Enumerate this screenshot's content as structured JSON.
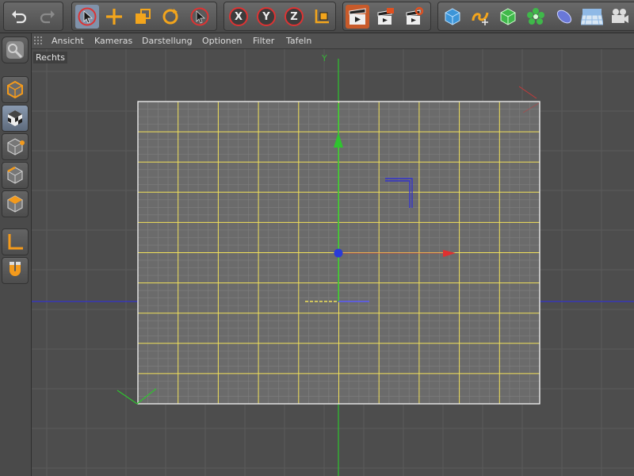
{
  "toolbar": {
    "groups": [
      "undo-redo",
      "tools",
      "axis-lock",
      "render",
      "objects"
    ],
    "axis_labels": {
      "x": "X",
      "y": "Y",
      "z": "Z"
    }
  },
  "menubar": {
    "items": [
      {
        "label": "Ansicht"
      },
      {
        "label": "Kameras"
      },
      {
        "label": "Darstellung"
      },
      {
        "label": "Optionen"
      },
      {
        "label": "Filter"
      },
      {
        "label": "Tafeln"
      }
    ]
  },
  "left_toolbar": {
    "active_tool": "model-mode"
  },
  "viewport": {
    "label": "Rechts",
    "axis_label": "Y",
    "plane": {
      "columns": 10,
      "rows": 10,
      "subdivisions": 4
    },
    "colors": {
      "background": "#4d4d4d",
      "grid_line": "#5a5a5a",
      "plane_fill": "#6b6b6b",
      "plane_wire": "#f2e15a",
      "y_axis": "#2fc42f",
      "z_axis": "#3333cc",
      "x_handle": "#e03030",
      "pivot": "#2a3bd8"
    }
  }
}
